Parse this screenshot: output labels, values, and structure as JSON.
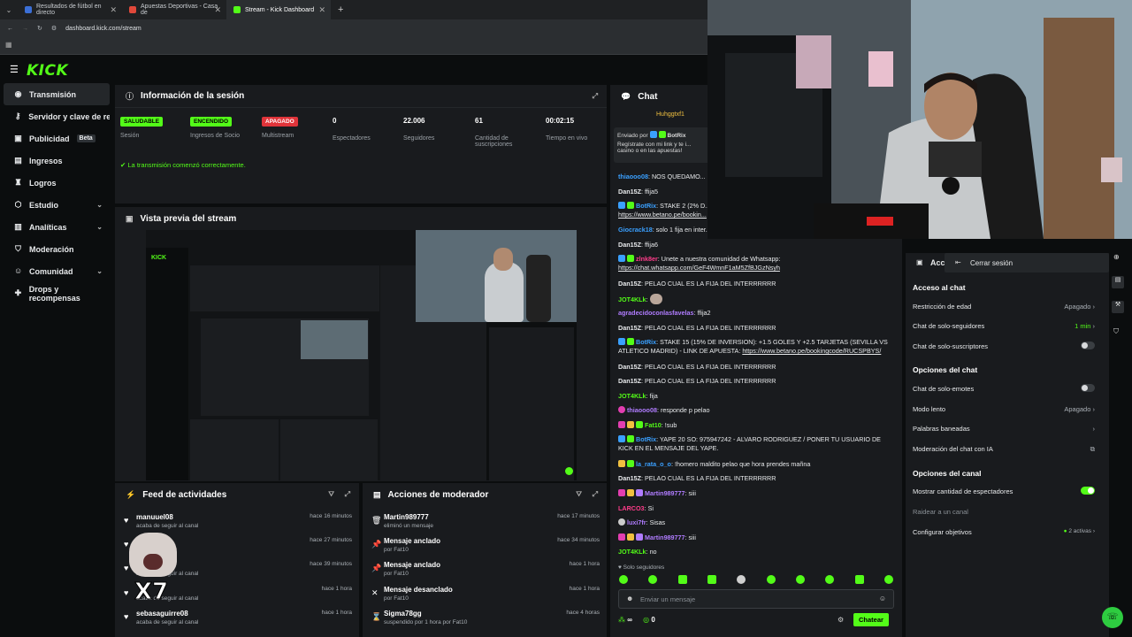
{
  "browser": {
    "tabs": [
      {
        "title": "Resultados de fútbol en directo",
        "color": "#3b6fd6"
      },
      {
        "title": "Apuestas Deportivas - Casa de",
        "color": "#e0483a"
      },
      {
        "title": "Stream - Kick Dashboard",
        "color": "#53fc18"
      }
    ],
    "url": "dashboard.kick.com/stream"
  },
  "brand": {
    "logo": "KICK",
    "accent": "#53fc18"
  },
  "sidebar": {
    "items": [
      {
        "label": "Transmisión",
        "icon": "broadcast-icon"
      },
      {
        "label": "Servidor y clave de retransmisión",
        "icon": "key-icon"
      },
      {
        "label": "Publicidad",
        "icon": "ad-icon",
        "badge": "Beta"
      },
      {
        "label": "Ingresos",
        "icon": "money-icon"
      },
      {
        "label": "Logros",
        "icon": "trophy-icon"
      },
      {
        "label": "Estudio",
        "icon": "studio-icon"
      },
      {
        "label": "Analíticas",
        "icon": "analytics-icon"
      },
      {
        "label": "Moderación",
        "icon": "shield-icon"
      },
      {
        "label": "Comunidad",
        "icon": "people-icon"
      },
      {
        "label": "Drops y recompensas",
        "icon": "gift-icon"
      }
    ]
  },
  "session": {
    "title": "Información de la sesión",
    "stats": [
      {
        "value": "SALUDABLE",
        "label": "Sesión"
      },
      {
        "value": "ENCENDIDO",
        "label": "Ingresos de Socio"
      },
      {
        "value": "APAGADO",
        "label": "Multistream"
      },
      {
        "value": "0",
        "label": "Espectadores"
      },
      {
        "value": "22.006",
        "label": "Seguidores"
      },
      {
        "value": "61",
        "label": "Cantidad de suscripciones"
      },
      {
        "value": "00:02:15",
        "label": "Tiempo en vivo"
      }
    ],
    "status_msg": "La transmisión comenzó correctamente."
  },
  "preview": {
    "title": "Vista previa del stream"
  },
  "feed": {
    "title": "Feed de actividades",
    "items": [
      {
        "name": "manuuel08",
        "sub": "acaba de seguir al canal",
        "time": "hace 16 minutos"
      },
      {
        "name": "",
        "sub": "",
        "time": "hace 27 minutos"
      },
      {
        "name": "",
        "sub": "acaba de seguir al canal",
        "time": "hace 39 minutos"
      },
      {
        "name": "",
        "sub": "acaba de seguir al canal",
        "time": "hace 1 hora"
      },
      {
        "name": "sebasaguirre08",
        "sub": "acaba de seguir al canal",
        "time": "hace 1 hora"
      }
    ]
  },
  "mod_actions": {
    "title": "Acciones de moderador",
    "items": [
      {
        "name": "Martin989777",
        "sub": "eliminó un mensaje",
        "time": "hace 17 minutos"
      },
      {
        "name": "Mensaje anclado",
        "sub": "por Fat10",
        "time": "hace 34 minutos"
      },
      {
        "name": "Mensaje anclado",
        "sub": "por Fat10",
        "time": "hace 1 hora"
      },
      {
        "name": "Mensaje desanclado",
        "sub": "por Fat10",
        "time": "hace 1 hora"
      },
      {
        "name": "Sigma78gg",
        "sub": "suspendido por 1 hora por Fat10",
        "time": "hace 4 horas"
      }
    ]
  },
  "chat": {
    "title": "Chat",
    "pinned_user": "Huhggtxf1",
    "pinned_from": "Enviado por",
    "pinned_by": "BotRix",
    "pinned_text": "Regístrate con mi link y te i... casino o en las apuestas!",
    "messages": [
      {
        "user": "thiaooo08",
        "color": "#3aa0ff",
        "text": "NOS QUEDAMO..."
      },
      {
        "user": "Dan15Z",
        "color": "#e8eaec",
        "text": "ffija5"
      },
      {
        "user": "BotRix",
        "color": "#3aa0ff",
        "text": "STAKE 2 (2% D...",
        "link": "https://www.betano.pe/bookin..."
      },
      {
        "user": "Giocrack18",
        "color": "#3aa0ff",
        "text": "solo 1 fija en inter..."
      },
      {
        "user": "Dan15Z",
        "color": "#e8eaec",
        "text": "ffija6"
      },
      {
        "user": "zlnk8er",
        "color": "#ff3c8a",
        "text": "Unete a nuestra comunidad de Whatsapp:",
        "link": "https://chat.whatsapp.com/GeF4WmnF1aM5ZfBJGzNsyh"
      },
      {
        "user": "Dan15Z",
        "color": "#e8eaec",
        "text": "PELAO CUAL ES LA FIJA DEL INTERRRRRR"
      },
      {
        "user": "JOT4KLk",
        "color": "#53fc18",
        "text": ""
      },
      {
        "user": "agradecidoconlasfavelas",
        "color": "#b07cff",
        "text": "ffija2"
      },
      {
        "user": "Dan15Z",
        "color": "#e8eaec",
        "text": "PELAO CUAL ES LA FIJA DEL INTERRRRRR"
      },
      {
        "user": "BotRix",
        "color": "#3aa0ff",
        "text": "STAKE 15 (15% DE INVERSION): +1.5 GOLES Y +2.5 TARJETAS (SEVILLA VS ATLETICO MADRID) - LINK DE APUESTA:",
        "link": "https://www.betano.pe/bookingcode/RUCSPBYS/"
      },
      {
        "user": "Dan15Z",
        "color": "#e8eaec",
        "text": "PELAO CUAL ES LA FIJA DEL INTERRRRRR"
      },
      {
        "user": "Dan15Z",
        "color": "#e8eaec",
        "text": "PELAO CUAL ES LA FIJA DEL INTERRRRRR"
      },
      {
        "user": "JOT4KLk",
        "color": "#53fc18",
        "text": "fija"
      },
      {
        "user": "thiaooo08",
        "color": "#b07cff",
        "text": "responde p pelao"
      },
      {
        "user": "Fat10",
        "color": "#53fc18",
        "text": "!sub"
      },
      {
        "user": "BotRix",
        "color": "#3aa0ff",
        "text": "YAPE 20 SO: 975947242 - ALVARO RODRIGUEZ / PONER TU USUARIO DE KICK EN EL MENSAJE DEL YAPE."
      },
      {
        "user": "la_rata_o_o",
        "color": "#3aa0ff",
        "text": "!homero maldito pelao que hora prendes mañna"
      },
      {
        "user": "Dan15Z",
        "color": "#e8eaec",
        "text": "PELAO CUAL ES LA FIJA DEL INTERRRRRR"
      },
      {
        "user": "Martin989777",
        "color": "#b07cff",
        "text": "siii"
      },
      {
        "user": "LARCO3",
        "color": "#ff3c8a",
        "text": "Si"
      },
      {
        "user": "luxi7fr",
        "color": "#b07cff",
        "text": "Sisas"
      },
      {
        "user": "Martin989777",
        "color": "#b07cff",
        "text": "siii"
      },
      {
        "user": "JOT4KLk",
        "color": "#53fc18",
        "text": "no"
      }
    ],
    "followers_only": "Solo seguidores",
    "input_placeholder": "Enviar un mensaje",
    "counter_a": "∞",
    "counter_b": "0",
    "send_label": "Chatear"
  },
  "mod_settings": {
    "title": "Acc",
    "logout": "Cerrar sesión",
    "section_access": "Acceso al chat",
    "age": {
      "label": "Restricción de edad",
      "value": "Apagado"
    },
    "followers": {
      "label": "Chat de solo-seguidores",
      "value": "1 min"
    },
    "subs": {
      "label": "Chat de solo-suscriptores"
    },
    "section_chat": "Opciones del chat",
    "emotes": {
      "label": "Chat de solo-emotes"
    },
    "slow": {
      "label": "Modo lento",
      "value": "Apagado"
    },
    "banned": {
      "label": "Palabras baneadas"
    },
    "ai": {
      "label": "Moderación del chat con IA"
    },
    "section_channel": "Opciones del canal",
    "viewer_count": {
      "label": "Mostrar cantidad de espectadores"
    },
    "raid": {
      "label": "Raidear a un canal"
    },
    "goals": {
      "label": "Configurar objetivos",
      "value": "2 activas"
    }
  },
  "overlay": {
    "sticker_text": "X7"
  }
}
